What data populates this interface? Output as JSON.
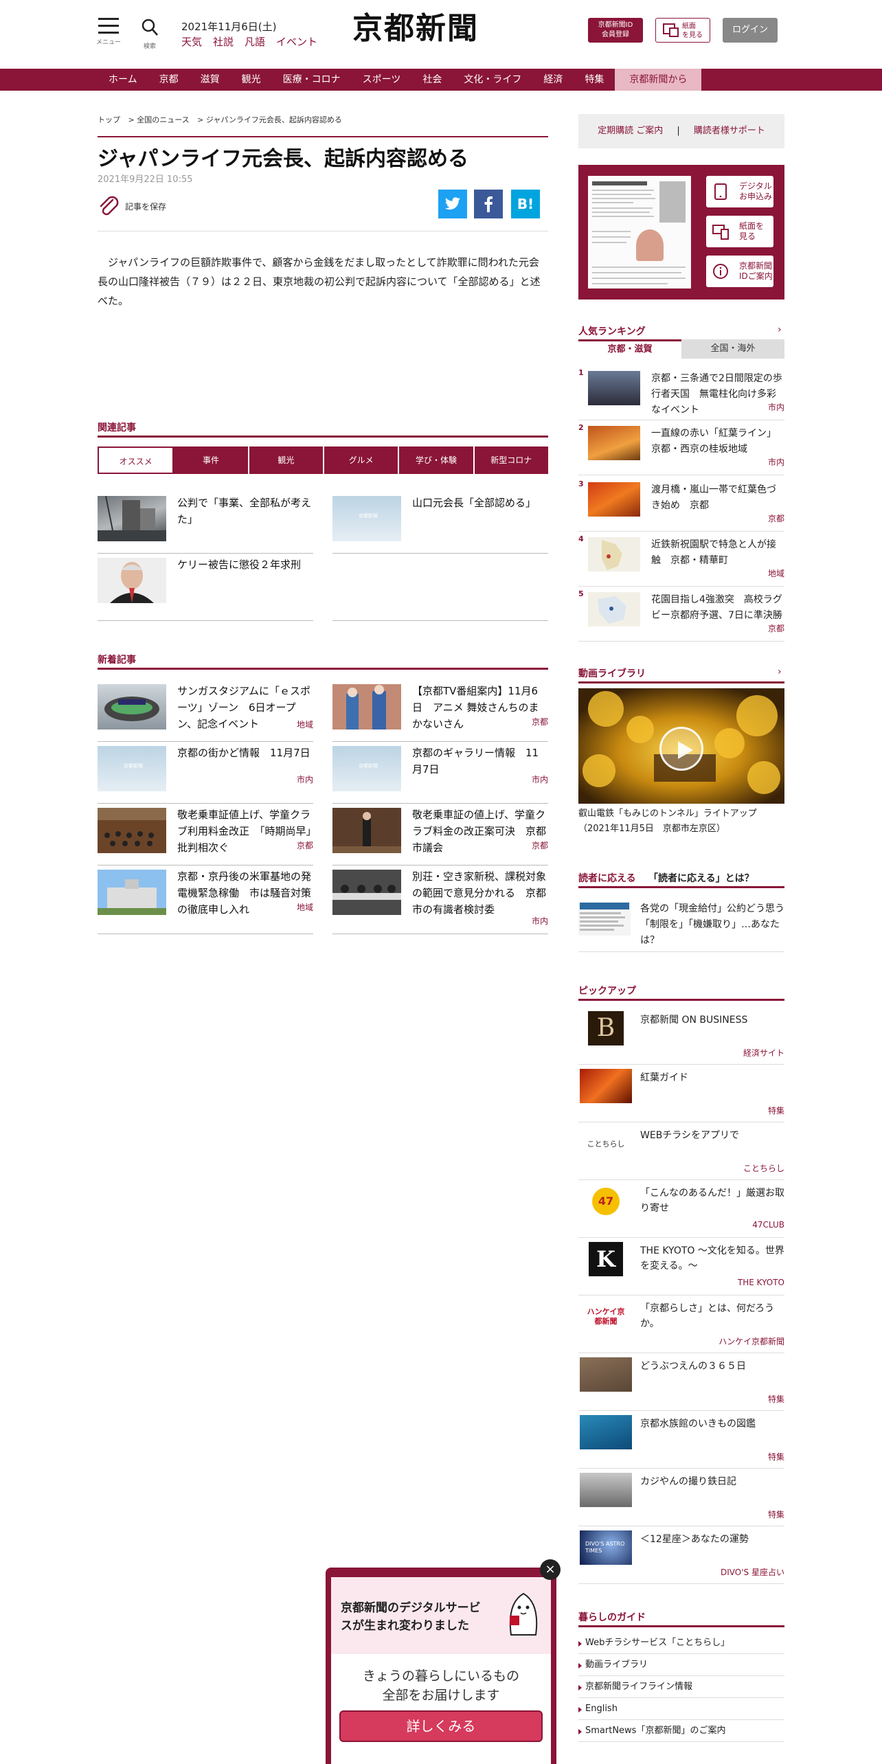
{
  "header": {
    "menu_label": "メニュー",
    "search_label": "検索",
    "date": "2021年11月6日(土)",
    "links": [
      "天気",
      "社説",
      "凡語",
      "イベント"
    ],
    "logo": "京都新聞",
    "member_button": [
      "京都新聞ID",
      "会員登録"
    ],
    "paper_button": [
      "紙面",
      "を見る"
    ],
    "login_button": "ログイン"
  },
  "nav": [
    "ホーム",
    "京都",
    "滋賀",
    "観光",
    "医療・コロナ",
    "スポーツ",
    "社会",
    "文化・ライフ",
    "経済",
    "特集",
    "京都新聞から"
  ],
  "breadcrumb": [
    "トップ",
    "> 全国のニュース",
    "> ジャパンライフ元会長、起訴内容認める"
  ],
  "article": {
    "title": "ジャパンライフ元会長、起訴内容認める",
    "date": "2021年9月22日 10:55",
    "save_label": "記事を保存",
    "share": [
      "twitter-icon",
      "facebook-icon",
      "hatena-icon"
    ],
    "hatena_label": "B!",
    "body": "ジャパンライフの巨額詐欺事件で、顧客から金銭をだまし取ったとして詐欺罪に問われた元会長の山口隆祥被告（７９）は２２日、東京地裁の初公判で起訴内容について「全部認める」と述べた。"
  },
  "related": {
    "heading": "関連記事",
    "tabs": [
      "オススメ",
      "事件",
      "観光",
      "グルメ",
      "学び・体験",
      "新型コロナ"
    ],
    "items": [
      {
        "title": "公判で「事業、全部私が考えた」"
      },
      {
        "title": "山口元会長「全部認める」"
      },
      {
        "title": "ケリー被告に懲役２年求刑"
      }
    ]
  },
  "latest": {
    "heading": "新着記事",
    "items": [
      {
        "title": "サンガスタジアムに「ｅスポーツ」ゾーン　6日オープン、記念イベント",
        "category": "地域"
      },
      {
        "title": "【京都TV番組案内】11月6日　アニメ 舞妓さんちのまかないさん",
        "category": "京都"
      },
      {
        "title": "京都の街かど情報　11月7日",
        "category": "市内"
      },
      {
        "title": "京都のギャラリー情報　11月7日",
        "category": "市内"
      },
      {
        "title": "敬老乗車証値上げ、学童クラブ利用料金改正　「時期尚早」批判相次ぐ",
        "category": "京都"
      },
      {
        "title": "敬老乗車証の値上げ、学童クラブ料金の改正案可決　京都市議会",
        "category": "京都"
      },
      {
        "title": "京都・京丹後の米軍基地の発電機緊急稼働　市は騒音対策の徹底申し入れ",
        "category": "地域"
      },
      {
        "title": "別荘・空き家新税、課税対象の範囲で意見分かれる　京都市の有識者検討委",
        "category": "市内"
      }
    ],
    "placeholder_mark": "京都新聞"
  },
  "sidebar": {
    "subscribe": [
      "定期購読 ご案内",
      "|",
      "購読者様サポート"
    ],
    "digital_buttons": [
      [
        "デジタル",
        "お申込み"
      ],
      [
        "紙面を",
        "見る"
      ],
      [
        "京都新聞",
        "IDご案内"
      ]
    ],
    "ranking": {
      "heading": "人気ランキング",
      "tabs": [
        "京都・滋賀",
        "全国・海外"
      ],
      "items": [
        {
          "num": "1",
          "title": "京都・三条通で2日間限定の歩行者天国　無電柱化向け多彩なイベント",
          "category": "市内"
        },
        {
          "num": "2",
          "title": "一直線の赤い「紅葉ライン」　京都・西京の桂坂地域",
          "category": "市内"
        },
        {
          "num": "3",
          "title": "渡月橋・嵐山一帯で紅葉色づき始め　京都",
          "category": "京都"
        },
        {
          "num": "4",
          "title": "近鉄新祝園駅で特急と人が接触　京都・精華町",
          "category": "地域"
        },
        {
          "num": "5",
          "title": "花園目指し4強激突　高校ラグビー京都府予選、7日に準決勝",
          "category": "京都"
        }
      ]
    },
    "video": {
      "heading": "動画ライブラリ",
      "caption": "叡山電鉄「もみじのトンネル」ライトアップ（2021年11月5日　京都市左京区）"
    },
    "reader": {
      "heading": "読者に応える",
      "link": "「読者に応える」とは？",
      "item": "各党の「現金給付」公約どう思う　「制限を」「機嫌取り」…あなたは？"
    },
    "pickup": {
      "heading": "ピックアップ",
      "items": [
        {
          "title": "京都新聞 ON BUSINESS",
          "tag": "経済サイト",
          "logo": "B"
        },
        {
          "title": "紅葉ガイド",
          "tag": "特集",
          "logo": ""
        },
        {
          "title": "WEBチラシをアプリで",
          "tag": "ことちらし",
          "logo": "ことちらし"
        },
        {
          "title": "「こんなのあるんだ！」厳選お取り寄せ",
          "tag": "47CLUB",
          "logo": "47"
        },
        {
          "title": "THE KYOTO ～文化を知る。世界を変える。～",
          "tag": "THE KYOTO",
          "logo": "K"
        },
        {
          "title": "「京都らしさ」とは、何だろうか。",
          "tag": "ハンケイ京都新聞",
          "logo": "ハンケイ京都新聞"
        },
        {
          "title": "どうぶつえんの３６５日",
          "tag": "特集",
          "logo": ""
        },
        {
          "title": "京都水族館のいきもの図鑑",
          "tag": "特集",
          "logo": ""
        },
        {
          "title": "カジやんの撮り鉄日記",
          "tag": "特集",
          "logo": ""
        },
        {
          "title": "＜12星座＞あなたの運勢",
          "tag": "DIVO'S 星座占い",
          "logo": "DIVO'S ASTRO TIMES"
        }
      ]
    },
    "guide": {
      "heading": "暮らしのガイド",
      "items": [
        "Webチラシサービス「ことちらし」",
        "動画ライブラリ",
        "京都新聞ライフライン情報",
        "English",
        "SmartNews「京都新聞」のご案内"
      ]
    }
  },
  "popup": {
    "title": "京都新聞のデジタルサービスが生まれ変わりました",
    "body": [
      "きょうの暮らしにいるもの",
      "全部をお届けします"
    ],
    "button": "詳しくみる",
    "close": "×"
  },
  "colors": {
    "brand": "#8a1538",
    "twitter": "#1da1f2",
    "facebook": "#3b5998",
    "hatena": "#00a4de"
  }
}
